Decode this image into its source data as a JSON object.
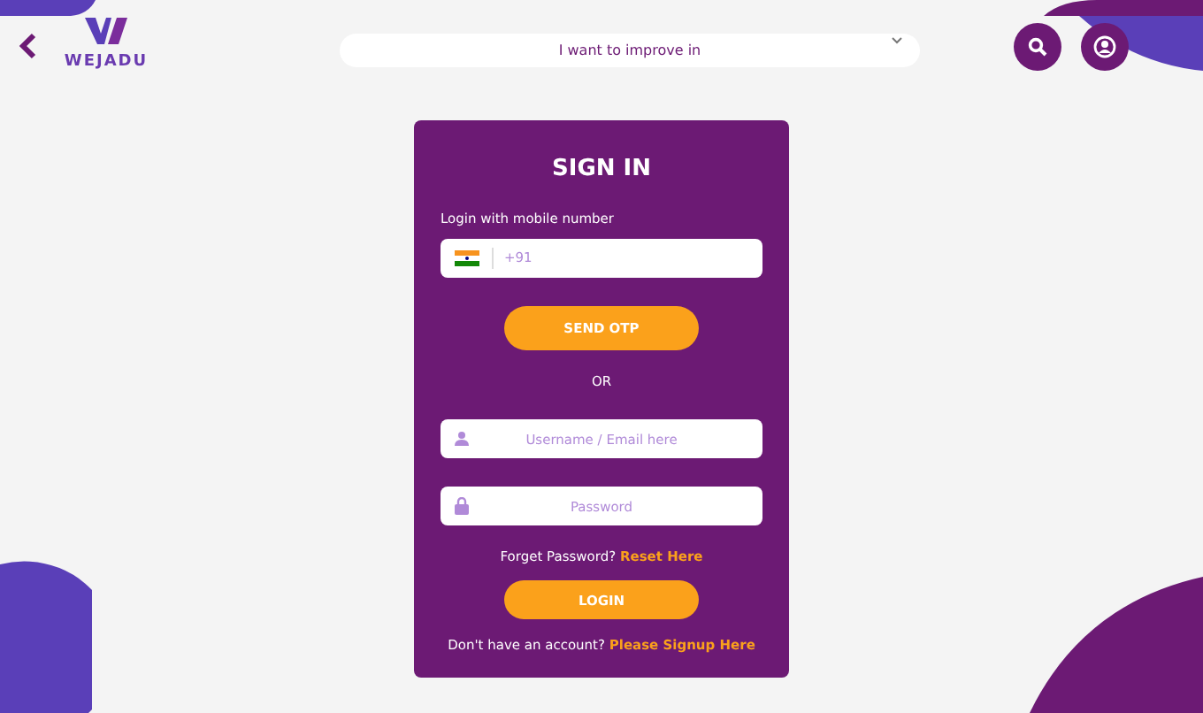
{
  "header": {
    "logo_text": "WEJADU",
    "goal_select": {
      "placeholder": "I want to improve in"
    }
  },
  "sign_in": {
    "title": "SIGN IN",
    "mobile_label": "Login with mobile number",
    "phone_field": {
      "placeholder": "+91"
    },
    "send_otp_button": "SEND OTP",
    "separator": "OR",
    "username_field": {
      "placeholder": "Username / Email here"
    },
    "password_field": {
      "placeholder": "Password"
    },
    "forgot_text": "Forget Password?",
    "reset_link": "Reset Here",
    "login_button": "LOGIN",
    "signup_text": "Don't have an account?",
    "signup_link": "Please Signup Here"
  }
}
